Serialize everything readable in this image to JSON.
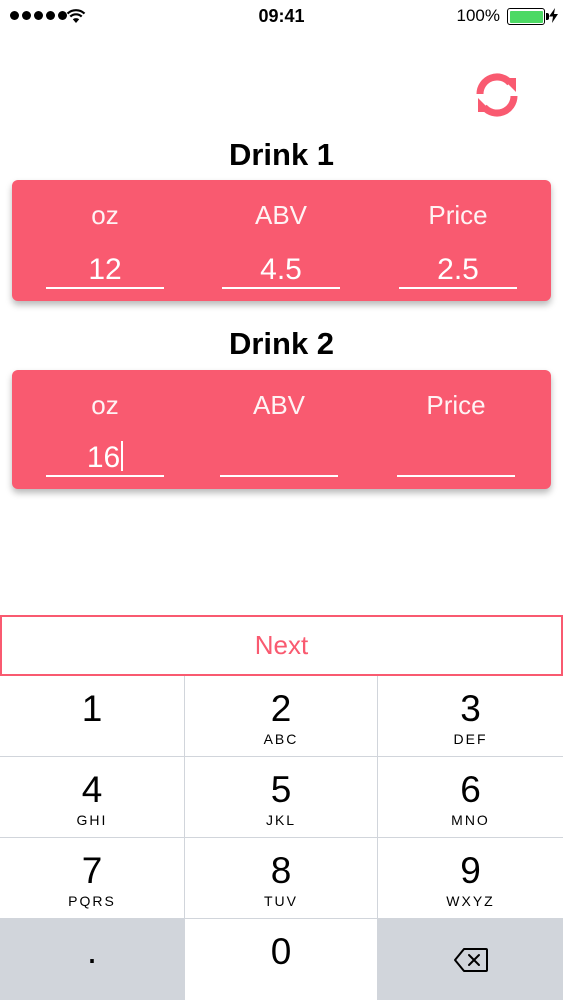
{
  "status_bar": {
    "time": "09:41",
    "battery_percent": "100%"
  },
  "drink1": {
    "title": "Drink 1",
    "oz_label": "oz",
    "abv_label": "ABV",
    "price_label": "Price",
    "oz_value": "12",
    "abv_value": "4.5",
    "price_value": "2.5"
  },
  "drink2": {
    "title": "Drink 2",
    "oz_label": "oz",
    "abv_label": "ABV",
    "price_label": "Price",
    "oz_value": "16",
    "abv_value": "",
    "price_value": ""
  },
  "next_label": "Next",
  "keypad": {
    "k1": {
      "digit": "1",
      "letters": ""
    },
    "k2": {
      "digit": "2",
      "letters": "ABC"
    },
    "k3": {
      "digit": "3",
      "letters": "DEF"
    },
    "k4": {
      "digit": "4",
      "letters": "GHI"
    },
    "k5": {
      "digit": "5",
      "letters": "JKL"
    },
    "k6": {
      "digit": "6",
      "letters": "MNO"
    },
    "k7": {
      "digit": "7",
      "letters": "PQRS"
    },
    "k8": {
      "digit": "8",
      "letters": "TUV"
    },
    "k9": {
      "digit": "9",
      "letters": "WXYZ"
    },
    "dot": ".",
    "k0": {
      "digit": "0"
    },
    "delete_icon": "backspace-icon"
  },
  "colors": {
    "accent": "#f95a70",
    "battery": "#4cd964",
    "keypad_bg": "#d1d5db"
  },
  "icons": {
    "refresh": "refresh-icon",
    "wifi": "wifi-icon",
    "battery": "battery-icon",
    "charging": "charging-bolt-icon"
  }
}
